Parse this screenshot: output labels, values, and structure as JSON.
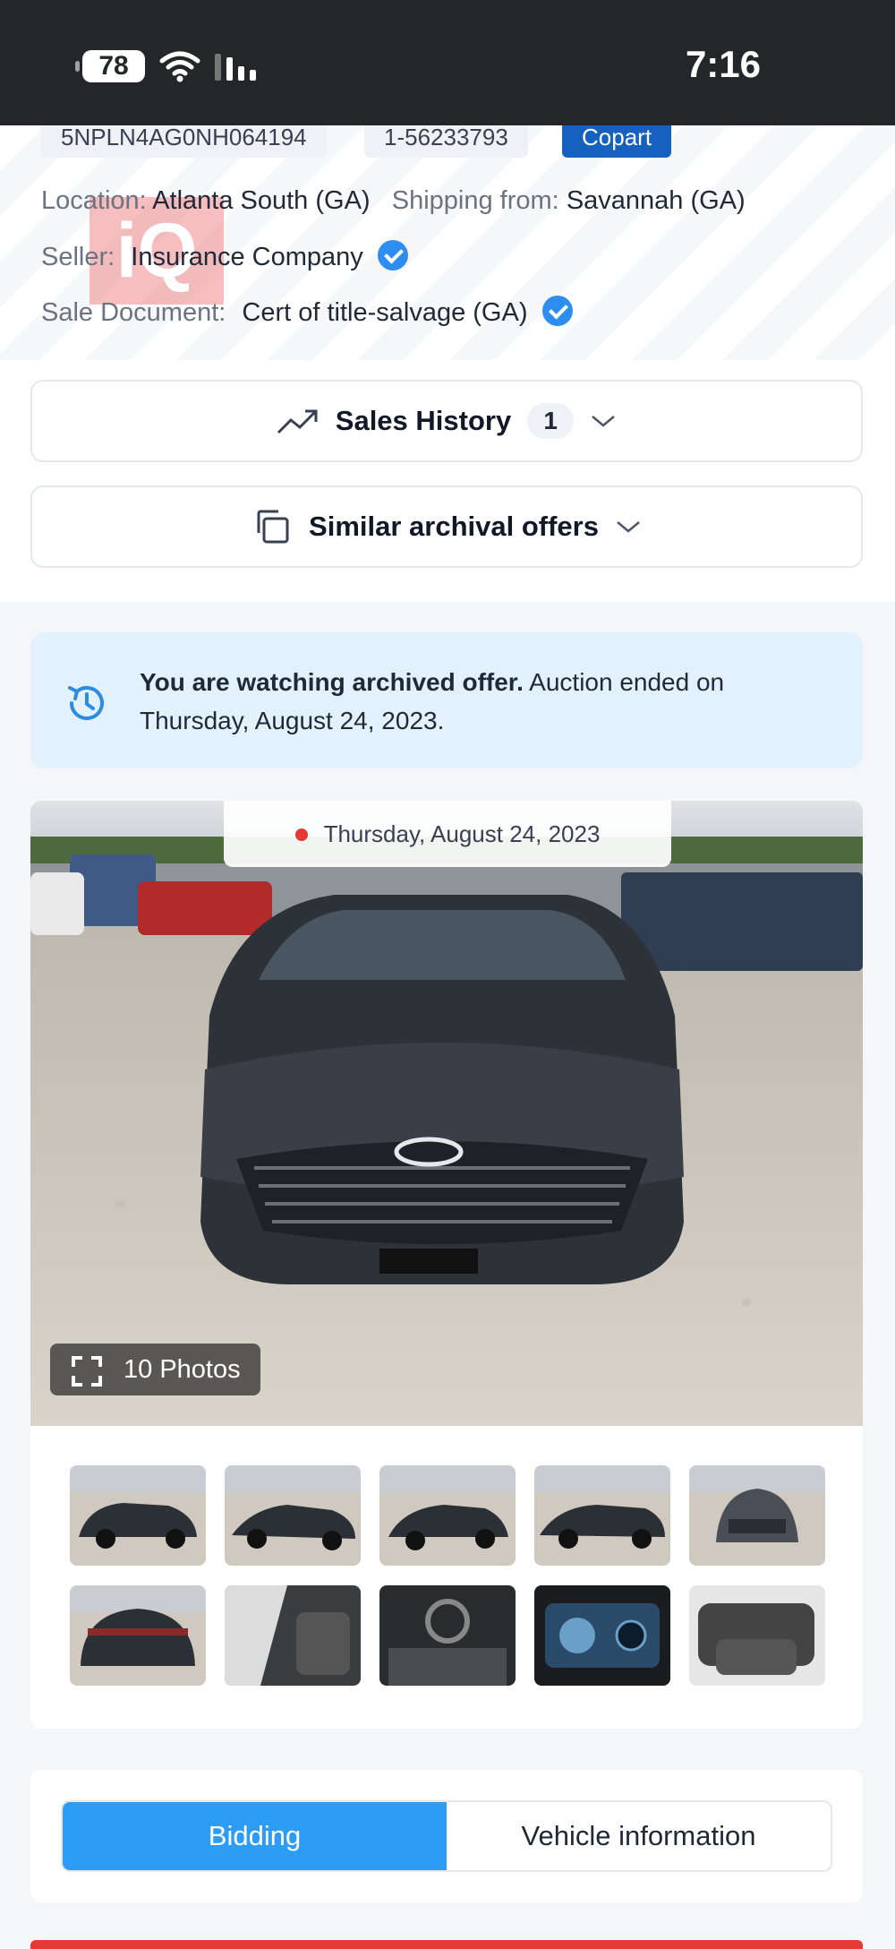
{
  "status_bar": {
    "battery": "78",
    "time": "7:16",
    "icons": [
      "wifi-icon",
      "signal-icon"
    ]
  },
  "listing": {
    "vin": "5NPLN4AG0NH064194",
    "lot": "1-56233793",
    "auction_house": "Copart",
    "location_label": "Location:",
    "location_value": "Atlanta South (GA)",
    "shipping_label": "Shipping from:",
    "shipping_value": "Savannah (GA)",
    "seller_label": "Seller:",
    "seller_value": "Insurance Company",
    "doc_label": "Sale Document:",
    "doc_value": "Cert of title-salvage (GA)"
  },
  "watermark": "iQ",
  "accordions": {
    "sales_history": {
      "title": "Sales History",
      "count": "1"
    },
    "similar": {
      "title": "Similar archival offers"
    }
  },
  "notice": {
    "bold": "You are watching archived offer.",
    "text": " Auction ended on Thursday, August 24, 2023."
  },
  "gallery": {
    "date": "Thursday, August 24, 2023",
    "photos_button": "10 Photos",
    "thumbnails": [
      "front-left",
      "left-side",
      "rear-right",
      "front-left-damage",
      "front",
      "rear",
      "interior-door",
      "dashboard",
      "instrument-cluster",
      "rear-seats"
    ]
  },
  "tabs": [
    {
      "label": "Bidding",
      "active": true
    },
    {
      "label": "Vehicle information",
      "active": false
    }
  ],
  "colors": {
    "accent": "#2d9cf5",
    "copart": "#1660c0",
    "verified": "#2e8ef0",
    "notice_bg": "#e3f1fd",
    "live_dot": "#e53935"
  }
}
